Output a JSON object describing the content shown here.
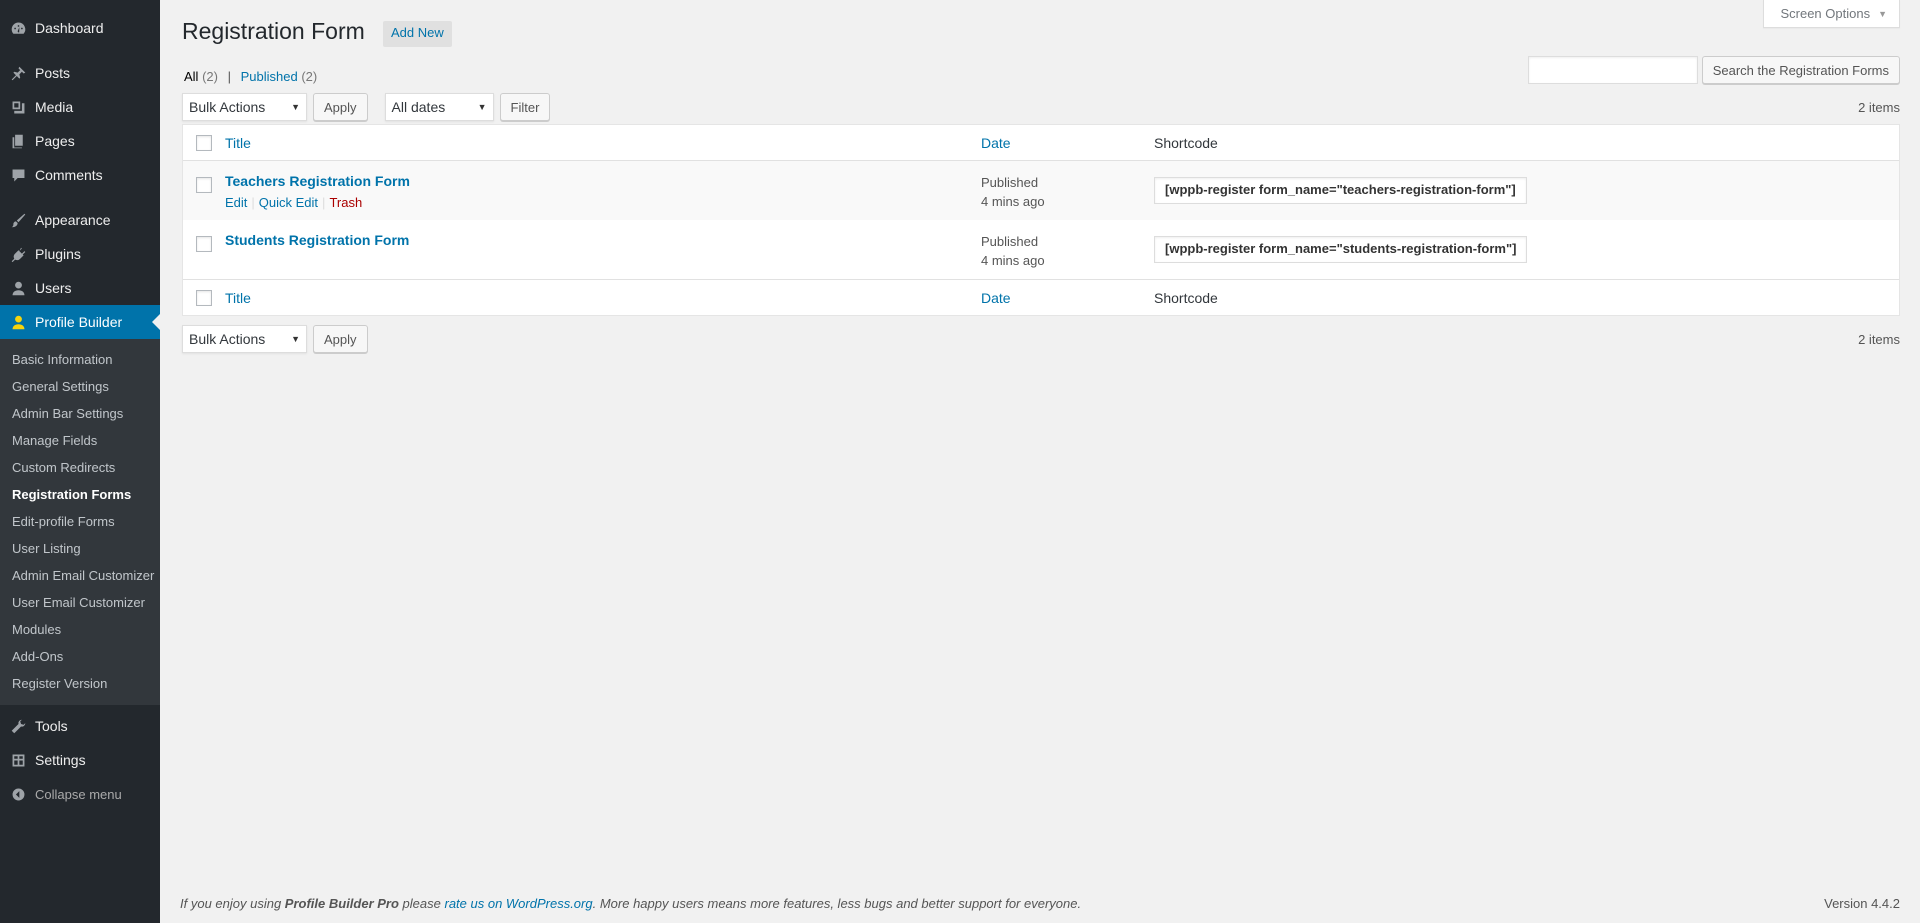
{
  "sidebar": {
    "dashboard": "Dashboard",
    "posts": "Posts",
    "media": "Media",
    "pages": "Pages",
    "comments": "Comments",
    "appearance": "Appearance",
    "plugins": "Plugins",
    "users": "Users",
    "profile_builder": "Profile Builder",
    "submenu": [
      "Basic Information",
      "General Settings",
      "Admin Bar Settings",
      "Manage Fields",
      "Custom Redirects",
      "Registration Forms",
      "Edit-profile Forms",
      "User Listing",
      "Admin Email Customizer",
      "User Email Customizer",
      "Modules",
      "Add-Ons",
      "Register Version"
    ],
    "tools": "Tools",
    "settings": "Settings",
    "collapse": "Collapse menu"
  },
  "header": {
    "screen_options": "Screen Options",
    "title": "Registration Form",
    "add_new": "Add New"
  },
  "views": {
    "all_label": "All",
    "all_count": "(2)",
    "published_label": "Published",
    "published_count": "(2)",
    "separator": "|"
  },
  "search": {
    "value": "",
    "button": "Search the Registration Forms"
  },
  "tablenav_top": {
    "bulk_actions": "Bulk Actions",
    "apply": "Apply",
    "dates": "All dates",
    "filter": "Filter",
    "items": "2 items"
  },
  "tablenav_bottom": {
    "bulk_actions": "Bulk Actions",
    "apply": "Apply",
    "items": "2 items"
  },
  "table": {
    "columns": {
      "title": "Title",
      "date": "Date",
      "shortcode": "Shortcode"
    },
    "rows": [
      {
        "title": "Teachers Registration Form",
        "status": "Published",
        "time": "4 mins ago",
        "shortcode": "[wppb-register form_name=\"teachers-registration-form\"]",
        "actions": {
          "edit": "Edit",
          "quick_edit": "Quick Edit",
          "trash": "Trash"
        }
      },
      {
        "title": "Students Registration Form",
        "status": "Published",
        "time": "4 mins ago",
        "shortcode": "[wppb-register form_name=\"students-registration-form\"]"
      }
    ]
  },
  "footer": {
    "text_before": "If you enjoy using ",
    "product": "Profile Builder Pro",
    "text_mid": " please ",
    "link": "rate us on WordPress.org",
    "text_after": ". More happy users means more features, less bugs and better support for everyone.",
    "version": "Version 4.4.2"
  },
  "colors": {
    "sidebar_bg": "#23282d",
    "submenu_bg": "#32373c",
    "accent": "#0073aa",
    "trash": "#aa0000",
    "active_icon": "#f5d40e"
  }
}
